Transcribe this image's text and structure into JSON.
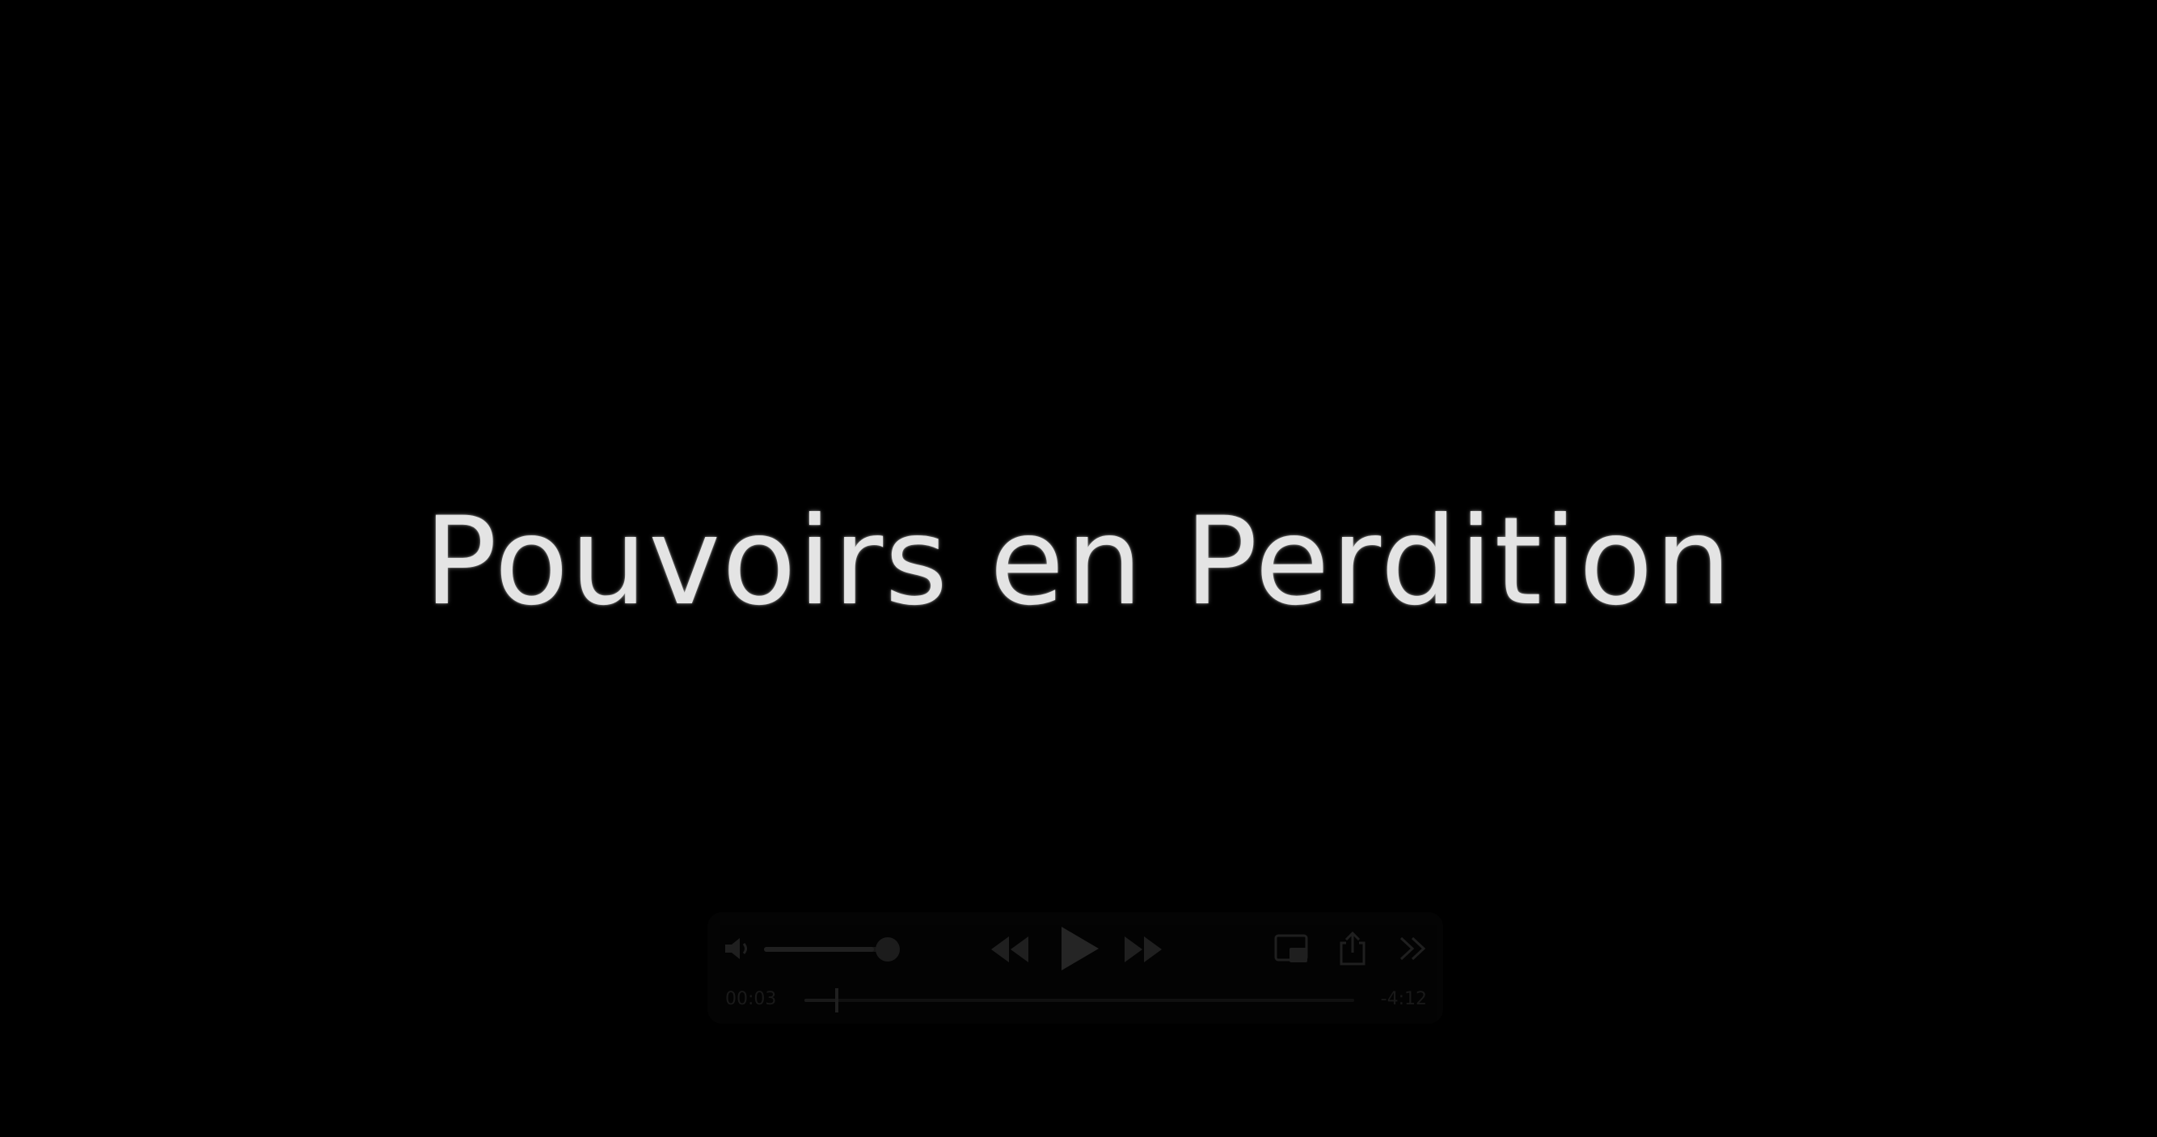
{
  "video": {
    "title_text": "Pouvoirs en Perdition"
  },
  "controls": {
    "current_time": "00:03",
    "remaining_time": "-4:12",
    "volume_level": 0.85,
    "progress": 0.06,
    "icons": {
      "volume": "speaker-icon",
      "rewind": "rewind-icon",
      "play": "play-icon",
      "fast_forward": "fast-forward-icon",
      "pip": "picture-in-picture-icon",
      "share": "share-icon",
      "expand": "chevron-right-double-icon"
    }
  },
  "colors": {
    "background": "#000000",
    "title": "#e4e4e4"
  }
}
